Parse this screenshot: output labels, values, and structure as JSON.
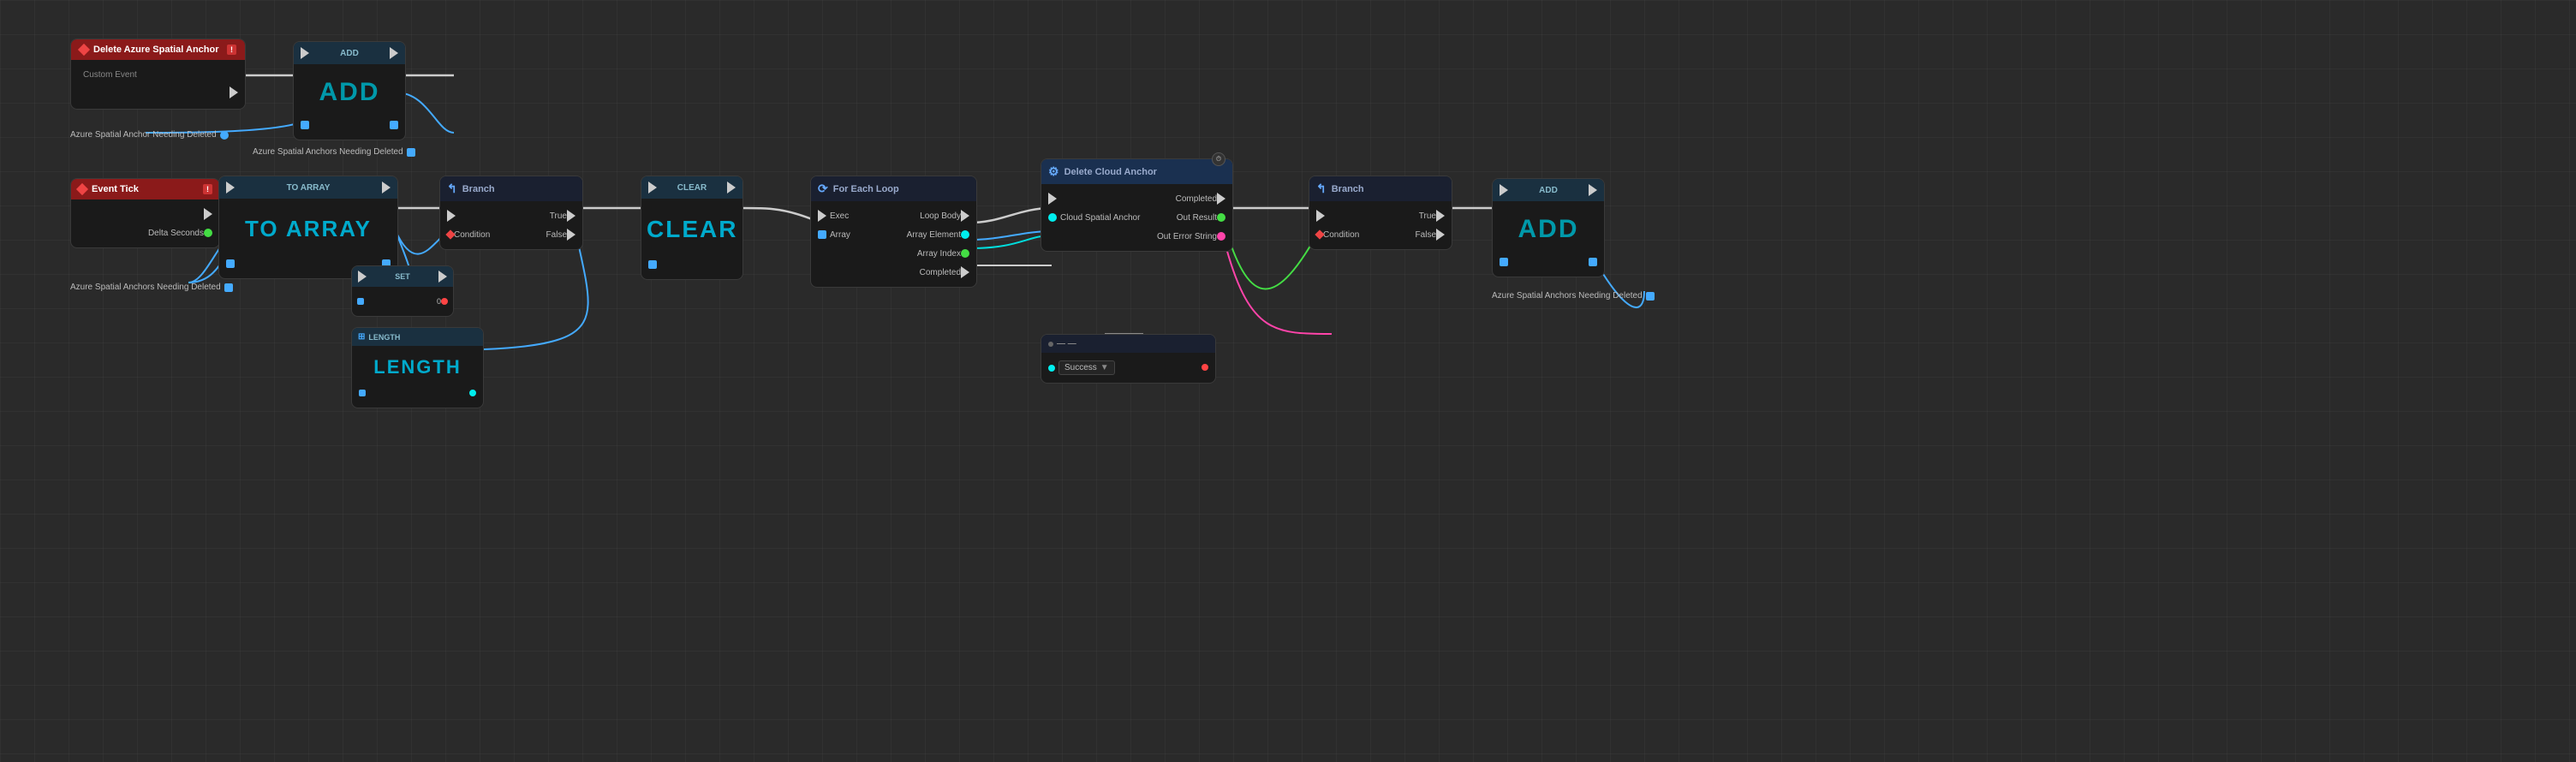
{
  "nodes": {
    "deleteAnchor": {
      "title": "Delete Azure Spatial Anchor",
      "subtitle": "Custom Event",
      "headerColor": "#8b1a1a",
      "pins": {
        "out": [
          "exec_out"
        ],
        "in": [
          "Azure Spatial Anchor Needing Deleted"
        ]
      }
    },
    "addTop": {
      "title": "ADD",
      "headerColor": "#1a2a3a",
      "bigLabel": "ADD"
    },
    "eventTick": {
      "title": "Event Tick",
      "headerColor": "#8b1a1a",
      "pins": {
        "out": [
          "exec_out",
          "Delta Seconds"
        ]
      }
    },
    "toArray": {
      "title": "TO ARRAY",
      "bigLabel": "TO ARRAY",
      "headerColor": "#1a2a3a"
    },
    "branch1": {
      "title": "Branch",
      "headerColor": "#1a2a3a",
      "pins": {
        "in": [
          "exec_in",
          "Condition"
        ],
        "out": [
          "True",
          "False"
        ]
      }
    },
    "clear": {
      "title": "CLEAR",
      "bigLabel": "CLEAR",
      "headerColor": "#1a2a3a"
    },
    "foreach": {
      "title": "For Each Loop",
      "headerColor": "#1a2a3a",
      "pins": {
        "in": [
          "Exec",
          "Array"
        ],
        "out": [
          "Loop Body",
          "Array Element",
          "Array Index",
          "Completed"
        ]
      }
    },
    "deleteCloud": {
      "title": "Delete Cloud Anchor",
      "headerColor": "#1a3a5a",
      "pins": {
        "in": [
          "exec_in",
          "Cloud Spatial Anchor"
        ],
        "out": [
          "Completed",
          "Out Result",
          "Out Error String"
        ]
      }
    },
    "branch2": {
      "title": "Branch",
      "headerColor": "#1a2a3a",
      "pins": {
        "in": [
          "exec_in",
          "Condition"
        ],
        "out": [
          "True",
          "False"
        ]
      }
    },
    "addBottom": {
      "title": "ADD",
      "bigLabel": "ADD",
      "headerColor": "#1a2a3a"
    },
    "length": {
      "title": "LENGTH",
      "bigLabel": "LENGTH",
      "headerColor": "#1a2a3a"
    },
    "successNode": {
      "title": "Success",
      "headerColor": "#1a2a3a"
    }
  },
  "labels": {
    "azureAnchorNeeding": "Azure Spatial Anchor Needing Deleted",
    "azureAnchorsNeeding": "Azure Spatial Anchors Needing Deleted",
    "deltaSeconds": "Delta Seconds",
    "condition": "Condition",
    "true": "True",
    "false": "False",
    "exec": "Exec",
    "array": "Array",
    "loopBody": "Loop Body",
    "arrayElement": "Array Element",
    "arrayIndex": "Array Index",
    "completed": "Completed",
    "cloudSpatialAnchor": "Cloud Spatial Anchor",
    "outResult": "Out Result",
    "outErrorString": "Out Error String",
    "success": "Success"
  },
  "colors": {
    "bg": "#2a2a2a",
    "nodeBg": "#1e1e1e",
    "nodeHeader": "#252525",
    "execColor": "#cccccc",
    "bluePin": "#44aaff",
    "tealPin": "#00dddd",
    "greenPin": "#44dd44",
    "redPin": "#ff4444",
    "pinkPin": "#ff44aa",
    "accentTeal": "#00cccc",
    "accentBlue": "#4488ff"
  }
}
